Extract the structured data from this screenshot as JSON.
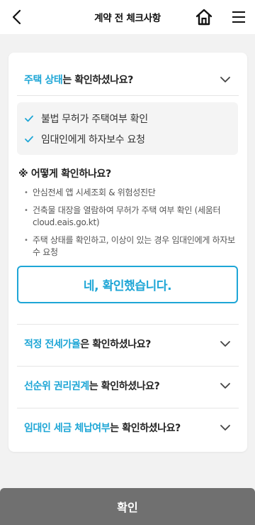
{
  "header": {
    "title": "계약 전 체크사항"
  },
  "sections": [
    {
      "highlight": "주택 상태",
      "rest": "는 확인하셨나요?",
      "expanded": true,
      "checks": [
        "불법 무허가 주택여부 확인",
        "임대인에게 하자보수 요청"
      ],
      "how_title": "※ 어떻게 확인하나요?",
      "bullets": [
        "안심전세 앱 시세조회 & 위험성진단",
        "건축물 대장을 열람하여 무허가 주택 여부 확인 (세움터 cloud.eais.go.kt)",
        "주택 상태를 확인하고, 이상이 있는 경우 임대인에게 하자보수 요청"
      ],
      "confirm_label": "네, 확인했습니다."
    },
    {
      "highlight": "적정 전세가율",
      "rest": "은 확인하셨나요?",
      "expanded": false
    },
    {
      "highlight": "선순위 권리권계",
      "rest": "는 확인하셨나요?",
      "expanded": false
    },
    {
      "highlight": "임대인 세금 체납여부",
      "rest": "는 확인하셨나요?",
      "expanded": false
    }
  ],
  "footer": {
    "button_label": "확인"
  },
  "colors": {
    "accent": "#1ea6d6",
    "footer_button": "#707070",
    "background": "#f2f2f2"
  },
  "icons": {
    "back": "chevron-left-icon",
    "home": "home-icon",
    "menu": "hamburger-menu-icon",
    "expand": "chevron-down-icon",
    "collapse": "chevron-up-icon",
    "check": "check-icon"
  }
}
